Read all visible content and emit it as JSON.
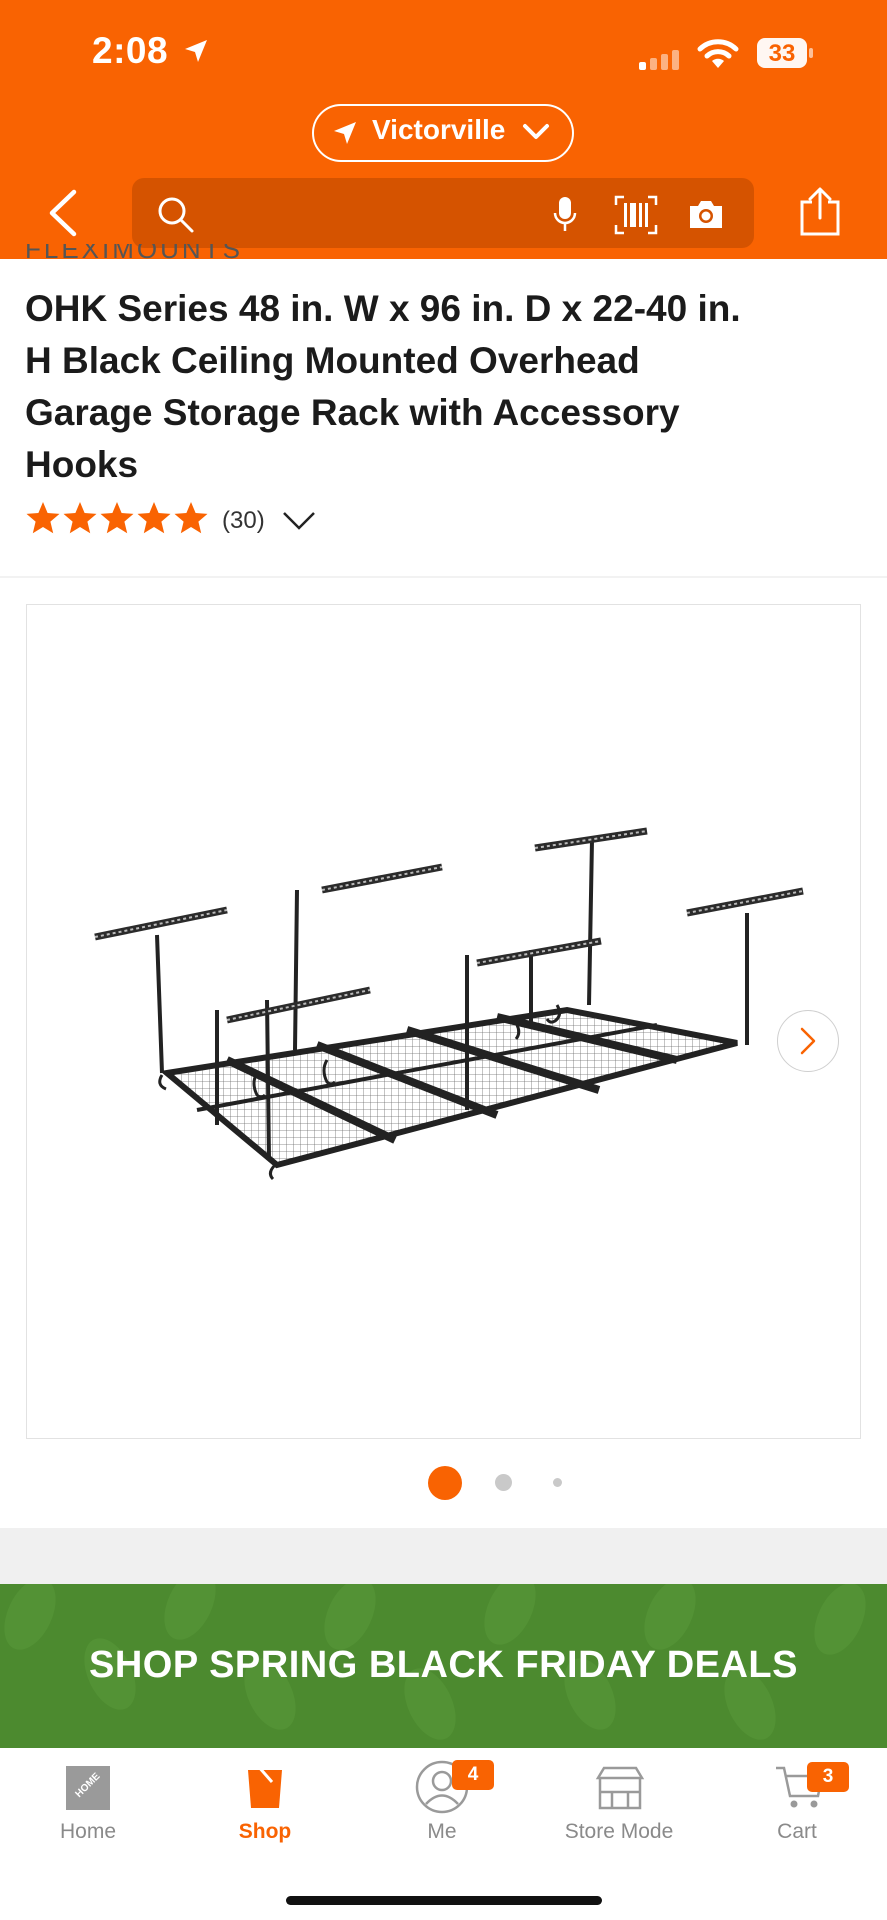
{
  "status_bar": {
    "time": "2:08",
    "battery": "33"
  },
  "location": {
    "label": "Victorville",
    "icon": "location-arrow-icon"
  },
  "search": {
    "placeholder": "",
    "icons": [
      "search-icon",
      "microphone-icon",
      "barcode-icon",
      "camera-icon"
    ]
  },
  "nav": {
    "back_icon": "chevron-left-icon",
    "share_icon": "share-icon"
  },
  "product": {
    "brand": "FLEXIMOUNTS",
    "title": "OHK Series 48 in. W x 96 in. D x 22-40 in. H Black Ceiling Mounted Overhead Garage Storage Rack with Accessory Hooks",
    "rating": 5,
    "review_count": "(30)",
    "image_alt": "black ceiling mounted overhead storage rack with hooks"
  },
  "carousel": {
    "current": 1,
    "total": 3
  },
  "promo": {
    "text": "SHOP SPRING BLACK FRIDAY DEALS"
  },
  "tabs": [
    {
      "label": "Home",
      "icon": "home-depot-logo-icon",
      "active": false
    },
    {
      "label": "Shop",
      "icon": "bucket-icon",
      "active": true
    },
    {
      "label": "Me",
      "icon": "user-icon",
      "active": false,
      "badge": "4"
    },
    {
      "label": "Store Mode",
      "icon": "store-icon",
      "active": false
    },
    {
      "label": "Cart",
      "icon": "cart-icon",
      "active": false,
      "badge": "3"
    }
  ],
  "colors": {
    "brand": "#f96302",
    "promo": "#4c8a2f",
    "star": "#f96302"
  }
}
